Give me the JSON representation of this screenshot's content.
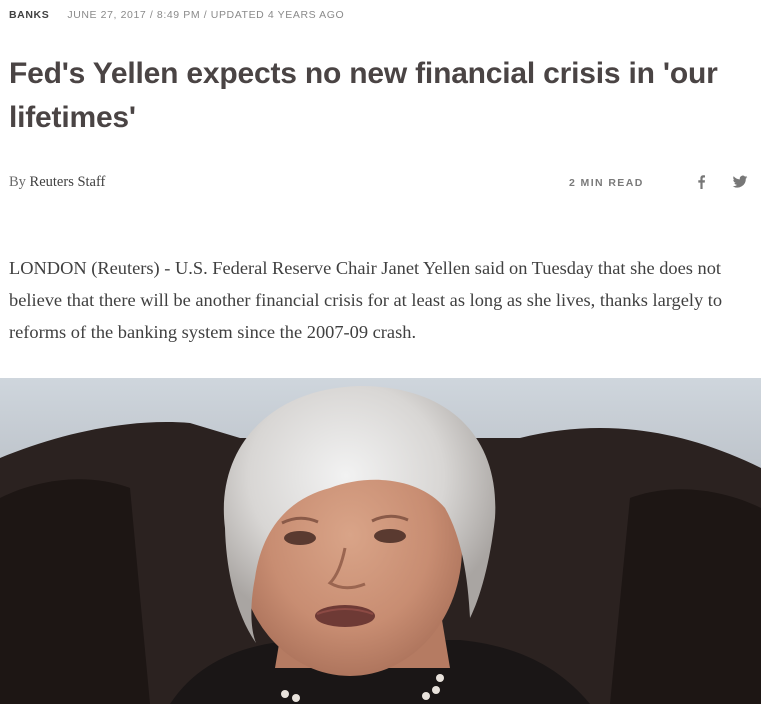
{
  "article": {
    "section": "BANKS",
    "date": "JUNE 27, 2017 / 8:49 PM / UPDATED 4 YEARS AGO",
    "headline": "Fed's Yellen expects no new financial crisis in 'our lifetimes'",
    "byline_prefix": "By",
    "author": "Reuters Staff",
    "read_time": "2 MIN READ",
    "body": "LONDON (Reuters) - U.S. Federal Reserve Chair Janet Yellen said on Tuesday that she does not believe that there will be another financial crisis for at least as long as she lives, thanks largely to reforms of the banking system since the 2007-09 crash."
  },
  "share": {
    "facebook_icon": "facebook-icon",
    "twitter_icon": "twitter-icon"
  },
  "colors": {
    "headline": "#4a4444",
    "body": "#404040",
    "meta": "#8a8a8a"
  }
}
